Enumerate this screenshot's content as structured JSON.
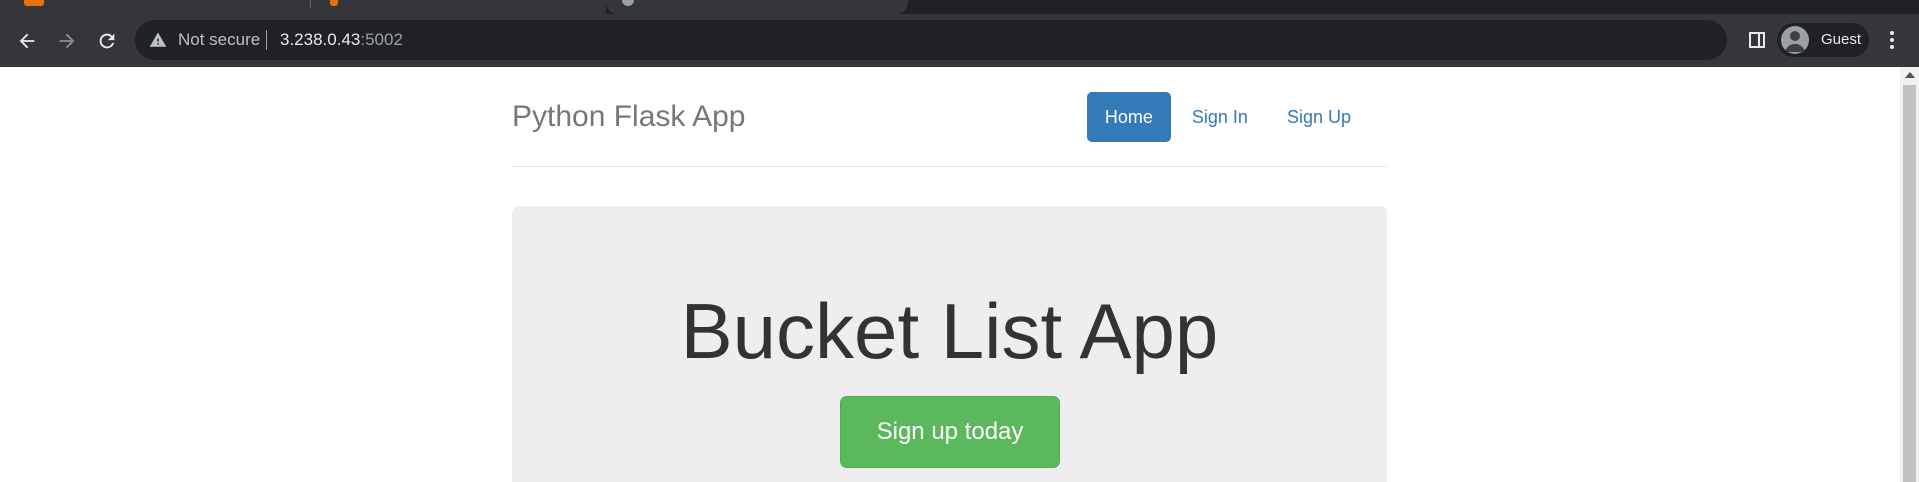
{
  "browser": {
    "address": {
      "security_label": "Not secure",
      "host": "3.238.0.43",
      "port": ":5002"
    },
    "profile_name": "Guest",
    "icons": [
      "back-icon",
      "forward-icon",
      "reload-icon",
      "warning-icon",
      "side-panel-icon",
      "profile-avatar-icon",
      "menu-icon"
    ]
  },
  "site": {
    "brand": "Python Flask App",
    "nav": [
      {
        "label": "Home",
        "active": true
      },
      {
        "label": "Sign In",
        "active": false
      },
      {
        "label": "Sign Up",
        "active": false
      }
    ],
    "hero": {
      "title": "Bucket List App",
      "cta_label": "Sign up today"
    }
  },
  "colors": {
    "nav_active": "#337ab7",
    "link": "#337ab7",
    "cta": "#5cb85c",
    "jumbotron_bg": "#eeeeee"
  }
}
